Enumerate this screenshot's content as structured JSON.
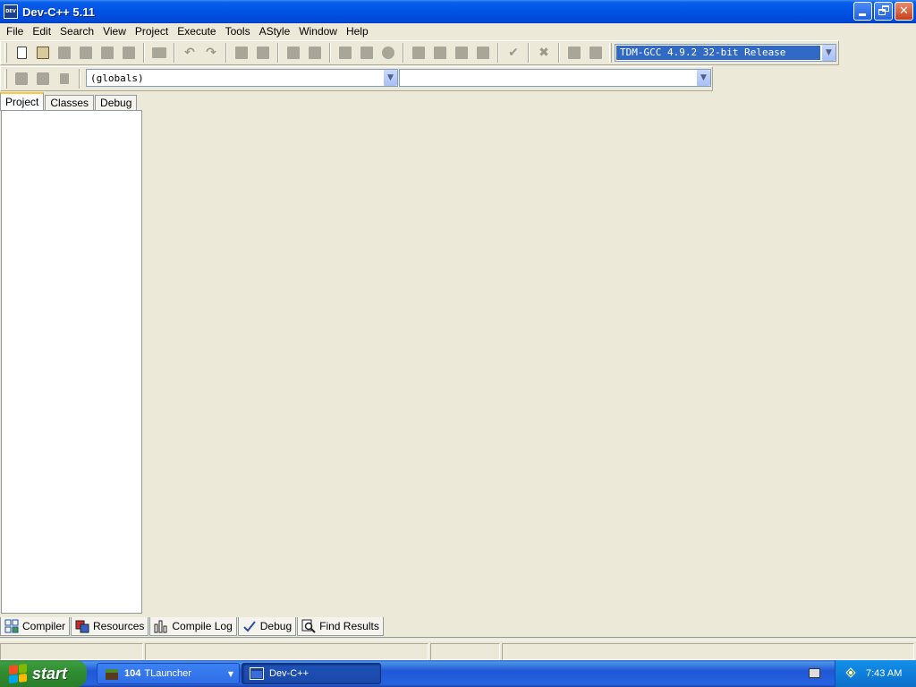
{
  "window": {
    "title": "Dev-C++ 5.11",
    "app_icon_text": "DEV"
  },
  "menu": [
    "File",
    "Edit",
    "Search",
    "View",
    "Project",
    "Execute",
    "Tools",
    "AStyle",
    "Window",
    "Help"
  ],
  "toolbar": {
    "compiler_select": "TDM-GCC 4.9.2 32-bit Release",
    "scope_select": "(globals)",
    "function_select": ""
  },
  "left_tabs": [
    "Project",
    "Classes",
    "Debug"
  ],
  "bottom_tabs": [
    "Compiler",
    "Resources",
    "Compile Log",
    "Debug",
    "Find Results"
  ],
  "taskbar": {
    "start_label": "start",
    "task1_count": "104",
    "task1_label": "TLauncher",
    "task2_label": "Dev-C++",
    "clock": "7:43 AM"
  },
  "colors": {
    "titlebar": "#0052E5",
    "face": "#ECE9D8",
    "selection": "#316AC5",
    "active_tab_accent": "#FFC83C"
  }
}
